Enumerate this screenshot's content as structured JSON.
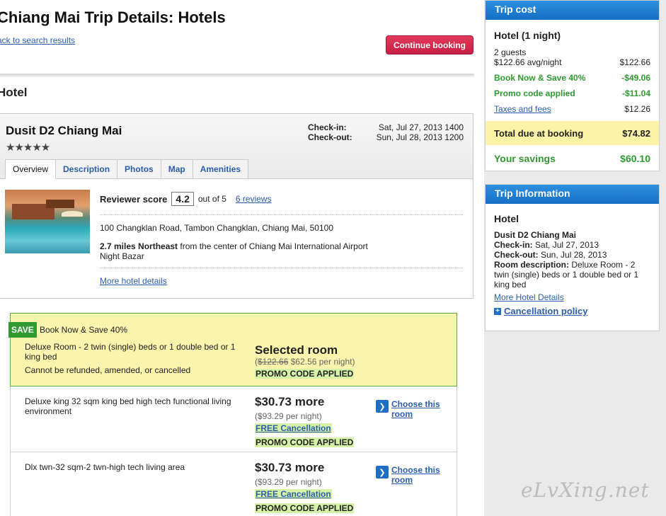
{
  "header": {
    "title": "Chiang Mai Trip Details: Hotels",
    "back_link": "ack to search results",
    "continue_button": "Continue booking"
  },
  "section_heading": "Hotel",
  "hotel": {
    "name": "Dusit D2 Chiang Mai",
    "stars": "★★★★★",
    "star_rating": 5,
    "checkin_label": "Check-in:",
    "checkin_value": "Sat, Jul 27, 2013 1400",
    "checkout_label": "Check-out:",
    "checkout_value": "Sun, Jul 28, 2013 1200",
    "tabs": [
      "Overview",
      "Description",
      "Photos",
      "Map",
      "Amenities"
    ],
    "reviewer_label": "Reviewer score",
    "score": "4.2",
    "out_of": "out of 5",
    "reviews_link": "6 reviews",
    "address": "100 Changklan Road, Tambon Changklan, Chiang Mai, 50100",
    "distance_bold": "2.7 miles Northeast",
    "distance_rest": " from the center of Chiang Mai International Airport",
    "landmark": "Night Bazar",
    "more_details": "More hotel details"
  },
  "rooms": {
    "selected": {
      "save_tag": "SAVE",
      "save_text": "Book Now & Save 40%",
      "desc": "Deluxe Room - 2 twin (single) beds or 1 double bed or 1 king bed",
      "policy": "Cannot be refunded, amended, or cancelled",
      "title": "Selected room",
      "old_price": "$122.66",
      "new_price": " $62.56 per night)",
      "promo": "PROMO CODE APPLIED"
    },
    "items": [
      {
        "desc": "Deluxe king 32 sqm king bed high tech functional living environment",
        "more": "$30.73 more",
        "per_night": "($93.29 per night)",
        "free_cancel": "FREE Cancellation",
        "promo": "PROMO CODE APPLIED",
        "choose": "Choose this room"
      },
      {
        "desc": "Dlx twn-32 sqm-2 twn-high tech living area",
        "more": "$30.73 more",
        "per_night": "($93.29 per night)",
        "free_cancel": "FREE Cancellation",
        "promo": "PROMO CODE APPLIED",
        "choose": "Choose this room"
      }
    ]
  },
  "trip_cost": {
    "header": "Trip cost",
    "title": "Hotel (1 night)",
    "guests": "2 guests",
    "avg_label": "$122.66 avg/night",
    "avg_value": "$122.66",
    "discount_label": "Book Now & Save 40%",
    "discount_value": "-$49.06",
    "promo_label": "Promo code applied",
    "promo_value": "-$11.04",
    "taxes_label": "Taxes and fees",
    "taxes_value": "$12.26",
    "total_label": "Total due at booking",
    "total_value": "$74.82",
    "savings_label": "Your savings",
    "savings_value": "$60.10"
  },
  "trip_info": {
    "header": "Trip Information",
    "title": "Hotel",
    "hotel_name": "Dusit D2 Chiang Mai",
    "checkin_label": "Check-in:",
    "checkin_value": " Sat, Jul 27, 2013",
    "checkout_label": "Check-out:",
    "checkout_value": " Sun, Jul 28, 2013",
    "room_label": "Room description:",
    "room_value": " Deluxe Room - 2 twin (single) beds or 1 double bed or 1 king bed",
    "more_link": "More Hotel Details",
    "cancel_link": "Cancellation policy"
  },
  "watermark": "eLvXing.net",
  "colors": {
    "accent_blue": "#166fc4",
    "button_red": "#c81e44",
    "save_green": "#2f9a2f",
    "highlight_yellow": "#fbf4ad"
  }
}
